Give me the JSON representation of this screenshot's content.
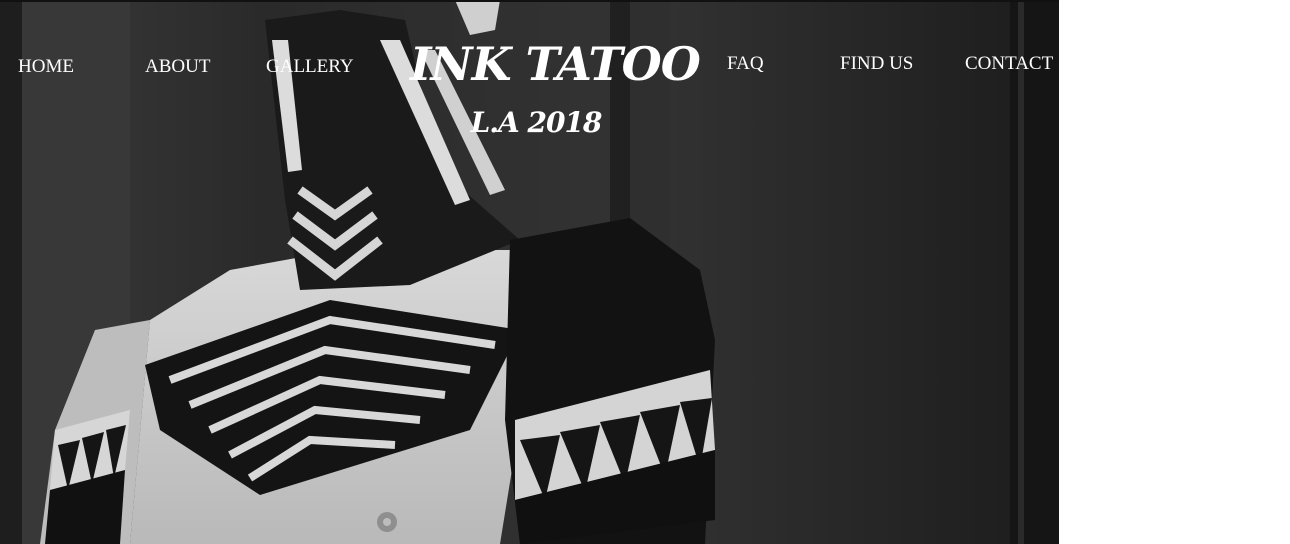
{
  "nav": {
    "home": "HOME",
    "about": "ABOUT",
    "gallery": "GALLERY",
    "faq": "FAQ",
    "find_us": "FIND US",
    "contact": "CONTACT"
  },
  "brand": {
    "title": "INK TATOO",
    "subtitle": "L.A 2018"
  },
  "hero": {
    "photo_subject": "black-and-white photo of tattooed neck and shoulders"
  }
}
